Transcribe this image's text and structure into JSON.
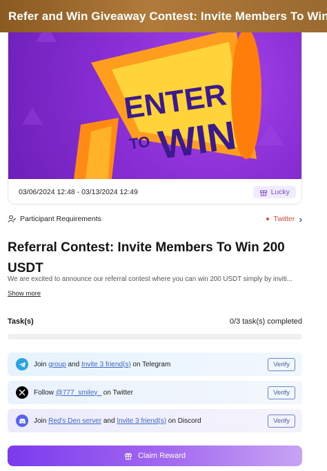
{
  "header": {
    "title": "Refer and Win Giveaway Contest: Invite Members To Win"
  },
  "banner": {
    "line1": "ENTER",
    "line2": "TO",
    "line3": "WIN"
  },
  "event": {
    "date_range": "03/06/2024 12:48 - 03/13/2024 12:49",
    "badge": "Lucky"
  },
  "requirements": {
    "label": "Participant Requirements",
    "platform": "Twitter"
  },
  "contest": {
    "title": "Referral Contest: Invite Members To Win 200 USDT",
    "description": "We are excited to announce our referral contest where you can win 200 USDT simply by inviti...",
    "show_more": "Show more"
  },
  "tasks": {
    "label": "Task(s)",
    "count": "0/3 task(s) completed",
    "items": [
      {
        "icon": "telegram-icon",
        "pre": "Join ",
        "link1": "group",
        "mid": " and ",
        "link2": "Invite 3 friend(s)",
        "post": " on Telegram",
        "button": "Verify",
        "color": "#2aa3df"
      },
      {
        "icon": "x-twitter-icon",
        "pre": "Follow ",
        "link1": "@777_smiley_",
        "mid": " on Twitter",
        "link2": "",
        "post": "",
        "button": "Verify",
        "color": "#000000"
      },
      {
        "icon": "discord-icon",
        "pre": "Join ",
        "link1": "Red's Den server",
        "mid": " and ",
        "link2": "Invite 3 friend(s)",
        "post": " on Discord",
        "button": "Verify",
        "color": "#5865f2"
      }
    ]
  },
  "claim": {
    "label": "Claim Reward"
  },
  "colors": {
    "accent": "#7c3aed",
    "banner": "#8a2fd6",
    "requirement": "#e0463a"
  }
}
